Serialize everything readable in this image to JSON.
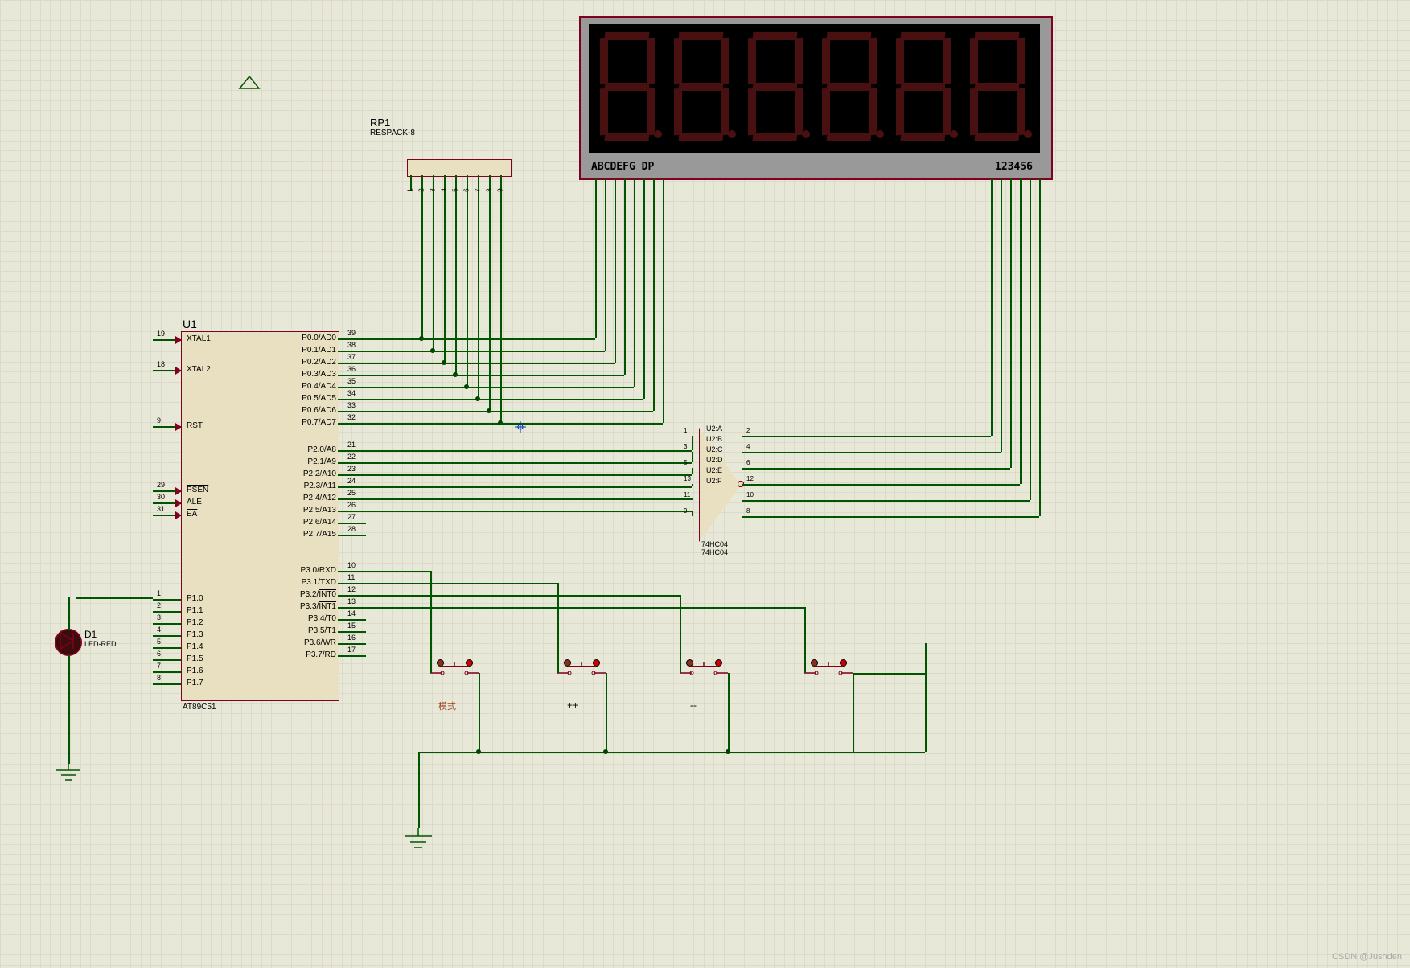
{
  "u1": {
    "ref": "U1",
    "part": "AT89C51",
    "left_pins": [
      {
        "num": "19",
        "name": "XTAL1"
      },
      {
        "num": "18",
        "name": "XTAL2"
      },
      {
        "num": "9",
        "name": "RST"
      },
      {
        "num": "29",
        "name": "PSEN",
        "over": true
      },
      {
        "num": "30",
        "name": "ALE"
      },
      {
        "num": "31",
        "name": "EA",
        "over": true
      },
      {
        "num": "1",
        "name": "P1.0"
      },
      {
        "num": "2",
        "name": "P1.1"
      },
      {
        "num": "3",
        "name": "P1.2"
      },
      {
        "num": "4",
        "name": "P1.3"
      },
      {
        "num": "5",
        "name": "P1.4"
      },
      {
        "num": "6",
        "name": "P1.5"
      },
      {
        "num": "7",
        "name": "P1.6"
      },
      {
        "num": "8",
        "name": "P1.7"
      }
    ],
    "right_pins": [
      {
        "num": "39",
        "name": "P0.0/AD0"
      },
      {
        "num": "38",
        "name": "P0.1/AD1"
      },
      {
        "num": "37",
        "name": "P0.2/AD2"
      },
      {
        "num": "36",
        "name": "P0.3/AD3"
      },
      {
        "num": "35",
        "name": "P0.4/AD4"
      },
      {
        "num": "34",
        "name": "P0.5/AD5"
      },
      {
        "num": "33",
        "name": "P0.6/AD6"
      },
      {
        "num": "32",
        "name": "P0.7/AD7"
      },
      {
        "num": "21",
        "name": "P2.0/A8"
      },
      {
        "num": "22",
        "name": "P2.1/A9"
      },
      {
        "num": "23",
        "name": "P2.2/A10"
      },
      {
        "num": "24",
        "name": "P2.3/A11"
      },
      {
        "num": "25",
        "name": "P2.4/A12"
      },
      {
        "num": "26",
        "name": "P2.5/A13"
      },
      {
        "num": "27",
        "name": "P2.6/A14"
      },
      {
        "num": "28",
        "name": "P2.7/A15"
      },
      {
        "num": "10",
        "name": "P3.0/RXD"
      },
      {
        "num": "11",
        "name": "P3.1/TXD"
      },
      {
        "num": "12",
        "name": "P3.2/INT0",
        "partial_over": "INT0"
      },
      {
        "num": "13",
        "name": "P3.3/INT1",
        "partial_over": "INT1"
      },
      {
        "num": "14",
        "name": "P3.4/T0"
      },
      {
        "num": "15",
        "name": "P3.5/T1"
      },
      {
        "num": "16",
        "name": "P3.6/WR",
        "partial_over": "WR"
      },
      {
        "num": "17",
        "name": "P3.7/RD",
        "partial_over": "RD"
      }
    ]
  },
  "rp1": {
    "ref": "RP1",
    "part": "RESPACK-8",
    "pins": [
      "1",
      "2",
      "3",
      "4",
      "5",
      "6",
      "7",
      "8",
      "9"
    ]
  },
  "display": {
    "segments": "ABCDEFG  DP",
    "digits": "123456"
  },
  "u2": {
    "refs": [
      "U2:A",
      "U2:B",
      "U2:C",
      "U2:D",
      "U2:E",
      "U2:F"
    ],
    "part": "74HC04",
    "left_nums": [
      "1",
      "3",
      "5",
      "13",
      "11",
      "9"
    ],
    "right_nums": [
      "2",
      "4",
      "6",
      "12",
      "10",
      "8"
    ]
  },
  "d1": {
    "ref": "D1",
    "part": "LED-RED"
  },
  "buttons": {
    "b1": "模式",
    "b2": "++",
    "b3": "--",
    "b4": ""
  },
  "watermark": "CSDN @Jushden"
}
